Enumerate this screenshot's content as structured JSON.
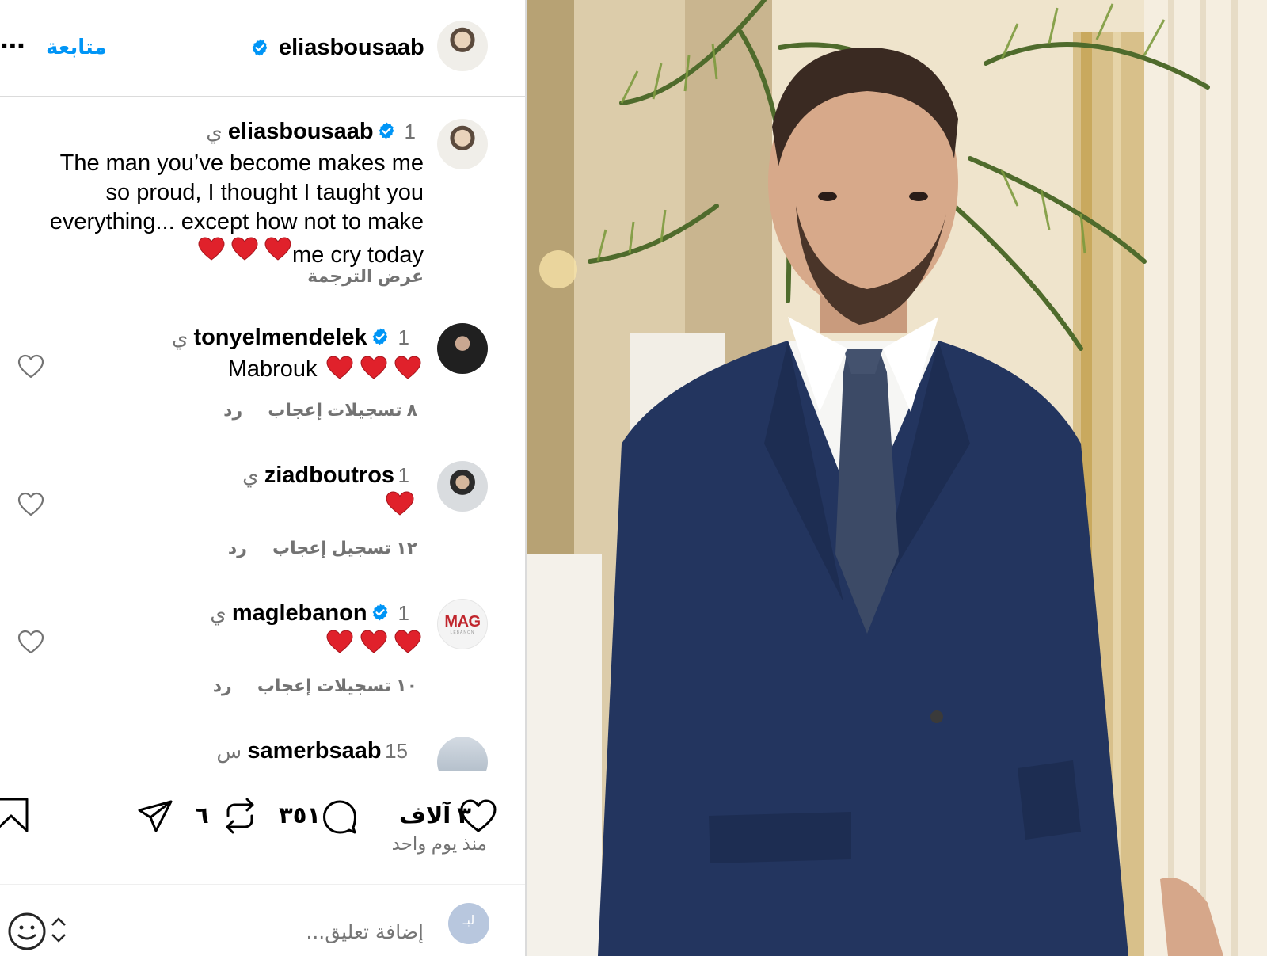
{
  "header": {
    "username": "eliasbousaab",
    "follow_label": "متابعة",
    "more_label": "⋯"
  },
  "caption": {
    "username": "eliasbousaab",
    "time": "1 ي",
    "lines": [
      "The man you’ve become makes me",
      "so proud, I thought I taught you",
      "everything... except how not to make",
      "me cry today"
    ],
    "translate_label": "عرض الترجمة"
  },
  "comments": [
    {
      "username": "tonyelmendelek",
      "verified": true,
      "time": "1 ي",
      "text": "Mabrouk",
      "hearts": 3,
      "likes": "٨ تسجيلات إعجاب",
      "reply": "رد"
    },
    {
      "username": "ziadboutros",
      "verified": false,
      "time": "1 ي",
      "text": "",
      "hearts": 1,
      "likes": "١٢ تسجيل إعجاب",
      "reply": "رد"
    },
    {
      "username": "maglebanon",
      "verified": true,
      "time": "1 ي",
      "text": "",
      "hearts": 3,
      "likes": "١٠ تسجيلات إعجاب",
      "reply": "رد"
    },
    {
      "username": "samerbsaab",
      "verified": false,
      "time": "15 س",
      "text": "",
      "hearts": 0,
      "likes": "",
      "reply": ""
    }
  ],
  "mag_avatar": {
    "logo": "MAG",
    "sub": "LEBANON"
  },
  "actions": {
    "likes_count": "٣ آلاف",
    "comments_count": "٣٥١",
    "reposts_count": "٦"
  },
  "posted_time": "منذ يوم واحد",
  "add_comment": {
    "placeholder": "إضافة تعليق...",
    "avatar_initial": "لبـ"
  },
  "colors": {
    "link_blue": "#0095f6",
    "verified_blue": "#0095f6",
    "heart_red": "#e0212b",
    "muted_gray": "#737373",
    "divider": "#dbdbdb"
  },
  "icons": [
    "more-icon",
    "verified-icon",
    "heart-outline-icon",
    "comment-icon",
    "repost-icon",
    "share-icon",
    "bookmark-icon",
    "emoji-icon",
    "red-heart-emoji"
  ]
}
